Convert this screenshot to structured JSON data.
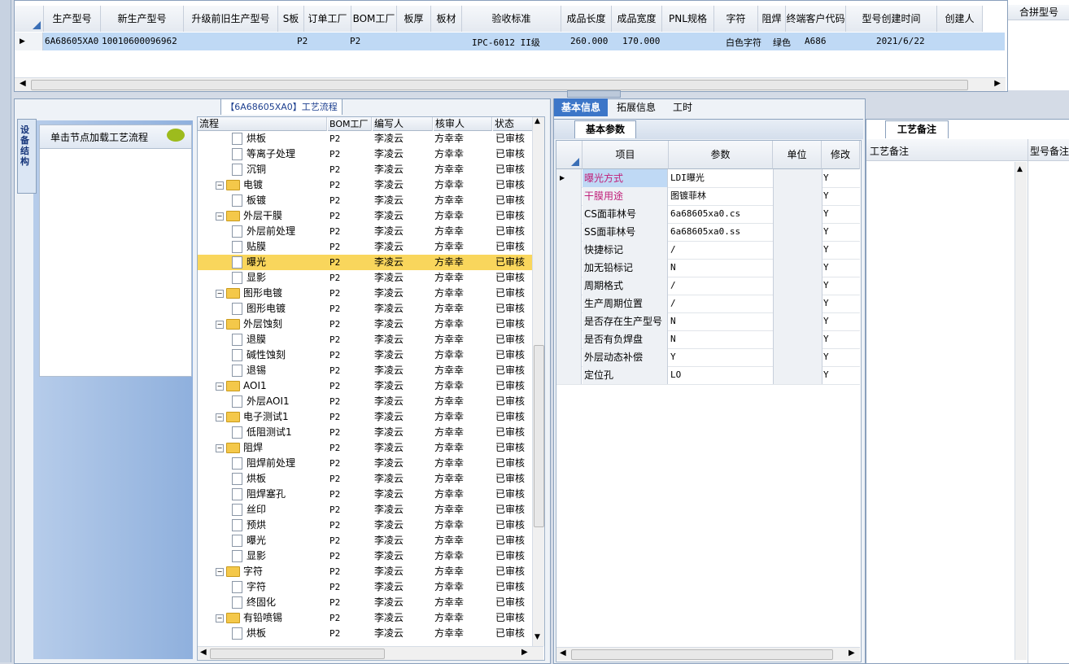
{
  "top_grid": {
    "headers": [
      "生产型号",
      "新生产型号",
      "升级前旧生产型号",
      "S板",
      "订单工厂",
      "BOM工厂",
      "板厚",
      "板材",
      "验收标准",
      "成品长度",
      "成品宽度",
      "PNL规格",
      "字符",
      "阻焊",
      "终端客户代码",
      "型号创建时间",
      "创建人"
    ],
    "row": {
      "prod_model": "6A68605XA0",
      "new_model": "10010600096962",
      "order_factory": "P2",
      "bom_factory": "P2",
      "standard": "IPC-6012 II级",
      "length": "260.000",
      "width": "170.000",
      "char": "白色字符",
      "solder": "绿色",
      "customer": "A686",
      "created": "2021/6/22"
    },
    "right_header": "合拼型号"
  },
  "left": {
    "title": "【6A68605XA0】工艺流程",
    "side_tab": "设备结构",
    "node_hint": "单击节点加载工艺流程",
    "tree_headers": [
      "流程",
      "BOM工厂",
      "编写人",
      "核审人",
      "状态"
    ],
    "tree_rows": [
      {
        "name": "烘板",
        "level": 1,
        "folder": false,
        "bom": "P2",
        "writer": "李凌云",
        "reviewer": "方幸幸",
        "status": "已审核"
      },
      {
        "name": "等离子处理",
        "level": 1,
        "folder": false,
        "bom": "P2",
        "writer": "李凌云",
        "reviewer": "方幸幸",
        "status": "已审核"
      },
      {
        "name": "沉铜",
        "level": 1,
        "folder": false,
        "bom": "P2",
        "writer": "李凌云",
        "reviewer": "方幸幸",
        "status": "已审核"
      },
      {
        "name": "电镀",
        "level": 0,
        "folder": true,
        "bom": "P2",
        "writer": "李凌云",
        "reviewer": "方幸幸",
        "status": "已审核"
      },
      {
        "name": "板镀",
        "level": 1,
        "folder": false,
        "bom": "P2",
        "writer": "李凌云",
        "reviewer": "方幸幸",
        "status": "已审核"
      },
      {
        "name": "外层干膜",
        "level": 0,
        "folder": true,
        "bom": "P2",
        "writer": "李凌云",
        "reviewer": "方幸幸",
        "status": "已审核"
      },
      {
        "name": "外层前处理",
        "level": 1,
        "folder": false,
        "bom": "P2",
        "writer": "李凌云",
        "reviewer": "方幸幸",
        "status": "已审核"
      },
      {
        "name": "贴膜",
        "level": 1,
        "folder": false,
        "bom": "P2",
        "writer": "李凌云",
        "reviewer": "方幸幸",
        "status": "已审核"
      },
      {
        "name": "曝光",
        "level": 1,
        "folder": false,
        "bom": "P2",
        "writer": "李凌云",
        "reviewer": "方幸幸",
        "status": "已审核",
        "selected": true
      },
      {
        "name": "显影",
        "level": 1,
        "folder": false,
        "bom": "P2",
        "writer": "李凌云",
        "reviewer": "方幸幸",
        "status": "已审核"
      },
      {
        "name": "图形电镀",
        "level": 0,
        "folder": true,
        "bom": "P2",
        "writer": "李凌云",
        "reviewer": "方幸幸",
        "status": "已审核"
      },
      {
        "name": "图形电镀",
        "level": 1,
        "folder": false,
        "bom": "P2",
        "writer": "李凌云",
        "reviewer": "方幸幸",
        "status": "已审核"
      },
      {
        "name": "外层蚀刻",
        "level": 0,
        "folder": true,
        "bom": "P2",
        "writer": "李凌云",
        "reviewer": "方幸幸",
        "status": "已审核"
      },
      {
        "name": "退膜",
        "level": 1,
        "folder": false,
        "bom": "P2",
        "writer": "李凌云",
        "reviewer": "方幸幸",
        "status": "已审核"
      },
      {
        "name": "碱性蚀刻",
        "level": 1,
        "folder": false,
        "bom": "P2",
        "writer": "李凌云",
        "reviewer": "方幸幸",
        "status": "已审核"
      },
      {
        "name": "退锡",
        "level": 1,
        "folder": false,
        "bom": "P2",
        "writer": "李凌云",
        "reviewer": "方幸幸",
        "status": "已审核"
      },
      {
        "name": "AOI1",
        "level": 0,
        "folder": true,
        "bom": "P2",
        "writer": "李凌云",
        "reviewer": "方幸幸",
        "status": "已审核"
      },
      {
        "name": "外层AOI1",
        "level": 1,
        "folder": false,
        "bom": "P2",
        "writer": "李凌云",
        "reviewer": "方幸幸",
        "status": "已审核"
      },
      {
        "name": "电子测试1",
        "level": 0,
        "folder": true,
        "bom": "P2",
        "writer": "李凌云",
        "reviewer": "方幸幸",
        "status": "已审核"
      },
      {
        "name": "低阻测试1",
        "level": 1,
        "folder": false,
        "bom": "P2",
        "writer": "李凌云",
        "reviewer": "方幸幸",
        "status": "已审核"
      },
      {
        "name": "阻焊",
        "level": 0,
        "folder": true,
        "bom": "P2",
        "writer": "李凌云",
        "reviewer": "方幸幸",
        "status": "已审核"
      },
      {
        "name": "阻焊前处理",
        "level": 1,
        "folder": false,
        "bom": "P2",
        "writer": "李凌云",
        "reviewer": "方幸幸",
        "status": "已审核"
      },
      {
        "name": "烘板",
        "level": 1,
        "folder": false,
        "bom": "P2",
        "writer": "李凌云",
        "reviewer": "方幸幸",
        "status": "已审核"
      },
      {
        "name": "阻焊塞孔",
        "level": 1,
        "folder": false,
        "bom": "P2",
        "writer": "李凌云",
        "reviewer": "方幸幸",
        "status": "已审核"
      },
      {
        "name": "丝印",
        "level": 1,
        "folder": false,
        "bom": "P2",
        "writer": "李凌云",
        "reviewer": "方幸幸",
        "status": "已审核"
      },
      {
        "name": "预烘",
        "level": 1,
        "folder": false,
        "bom": "P2",
        "writer": "李凌云",
        "reviewer": "方幸幸",
        "status": "已审核"
      },
      {
        "name": "曝光",
        "level": 1,
        "folder": false,
        "bom": "P2",
        "writer": "李凌云",
        "reviewer": "方幸幸",
        "status": "已审核"
      },
      {
        "name": "显影",
        "level": 1,
        "folder": false,
        "bom": "P2",
        "writer": "李凌云",
        "reviewer": "方幸幸",
        "status": "已审核"
      },
      {
        "name": "字符",
        "level": 0,
        "folder": true,
        "bom": "P2",
        "writer": "李凌云",
        "reviewer": "方幸幸",
        "status": "已审核"
      },
      {
        "name": "字符",
        "level": 1,
        "folder": false,
        "bom": "P2",
        "writer": "李凌云",
        "reviewer": "方幸幸",
        "status": "已审核"
      },
      {
        "name": "终固化",
        "level": 1,
        "folder": false,
        "bom": "P2",
        "writer": "李凌云",
        "reviewer": "方幸幸",
        "status": "已审核"
      },
      {
        "name": "有铅喷锡",
        "level": 0,
        "folder": true,
        "bom": "P2",
        "writer": "李凌云",
        "reviewer": "方幸幸",
        "status": "已审核"
      },
      {
        "name": "烘板",
        "level": 1,
        "folder": false,
        "bom": "P2",
        "writer": "李凌云",
        "reviewer": "方幸幸",
        "status": "已审核"
      }
    ]
  },
  "middle": {
    "tabs": [
      "基本信息",
      "拓展信息",
      "工时"
    ],
    "sub_tab": "基本参数",
    "headers": [
      "项目",
      "参数",
      "单位",
      "修改"
    ],
    "rows": [
      {
        "item": "曝光方式",
        "value": "LDI曝光",
        "unit": "",
        "mod": "Y",
        "color": "#c0207a",
        "selected": true
      },
      {
        "item": "干膜用途",
        "value": "图镀菲林",
        "unit": "",
        "mod": "Y",
        "color": "#c0207a"
      },
      {
        "item": "CS面菲林号",
        "value": "6a68605xa0.cs",
        "unit": "",
        "mod": "Y",
        "color": "#000000"
      },
      {
        "item": "SS面菲林号",
        "value": "6a68605xa0.ss",
        "unit": "",
        "mod": "Y",
        "color": "#000000"
      },
      {
        "item": "快捷标记",
        "value": "/",
        "unit": "",
        "mod": "Y",
        "color": "#000000"
      },
      {
        "item": "加无铅标记",
        "value": "N",
        "unit": "",
        "mod": "Y",
        "color": "#000000"
      },
      {
        "item": "周期格式",
        "value": "/",
        "unit": "",
        "mod": "Y",
        "color": "#000000"
      },
      {
        "item": "生产周期位置",
        "value": "/",
        "unit": "",
        "mod": "Y",
        "color": "#000000"
      },
      {
        "item": "是否存在生产型号",
        "value": "N",
        "unit": "",
        "mod": "Y",
        "color": "#000000"
      },
      {
        "item": "是否有负焊盘",
        "value": "N",
        "unit": "",
        "mod": "Y",
        "color": "#000000"
      },
      {
        "item": "外层动态补偿",
        "value": "Y",
        "unit": "",
        "mod": "Y",
        "color": "#000000"
      },
      {
        "item": "定位孔",
        "value": "LO",
        "unit": "",
        "mod": "Y",
        "color": "#000000"
      }
    ]
  },
  "right": {
    "tab": "工艺备注",
    "headers": [
      "工艺备注",
      "型号备注"
    ]
  }
}
